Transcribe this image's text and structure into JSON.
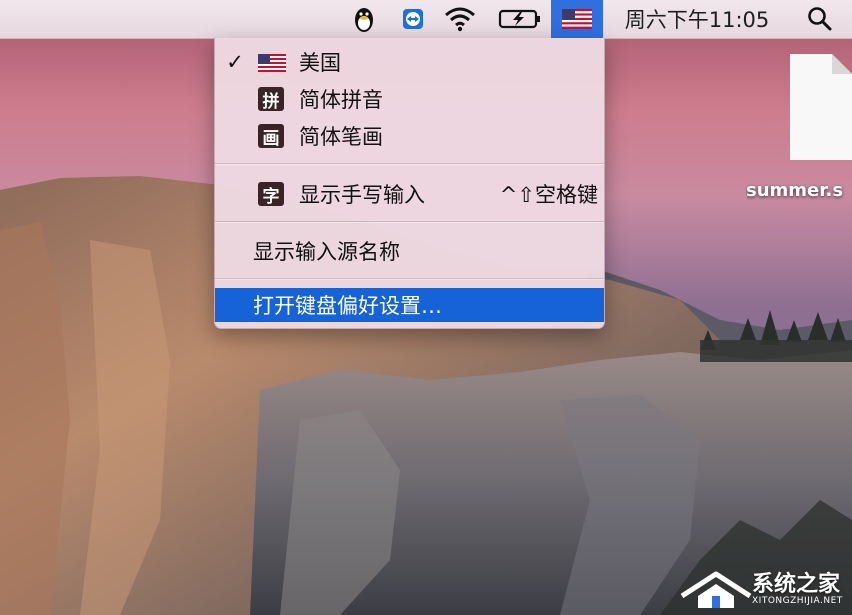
{
  "menubar": {
    "clock": "周六下午11:05",
    "icons": [
      "qq-penguin-icon",
      "teamviewer-icon",
      "wifi-icon",
      "battery-charging-icon",
      "us-flag-icon",
      "spotlight-search-icon"
    ]
  },
  "input_menu": {
    "items": [
      {
        "label": "美国",
        "checked": true,
        "icon": "us-flag-icon"
      },
      {
        "label": "简体拼音",
        "checked": false,
        "icon": "pinyin-icon",
        "icon_glyph": "拼"
      },
      {
        "label": "简体笔画",
        "checked": false,
        "icon": "stroke-icon",
        "icon_glyph": "画"
      }
    ],
    "handwriting": {
      "label": "显示手写输入",
      "icon_glyph": "字",
      "shortcut": "^⇧空格键"
    },
    "show_source_name": "显示输入源名称",
    "open_prefs": "打开键盘偏好设置…",
    "check_mark": "✓"
  },
  "desktop": {
    "file_label": "summer.s"
  },
  "watermark": {
    "name": "系统之家",
    "url": "XITONGZHIJIA.NET"
  },
  "colors": {
    "menu_highlight": "#1663d8",
    "menubar_active": "#2f6fe0"
  }
}
